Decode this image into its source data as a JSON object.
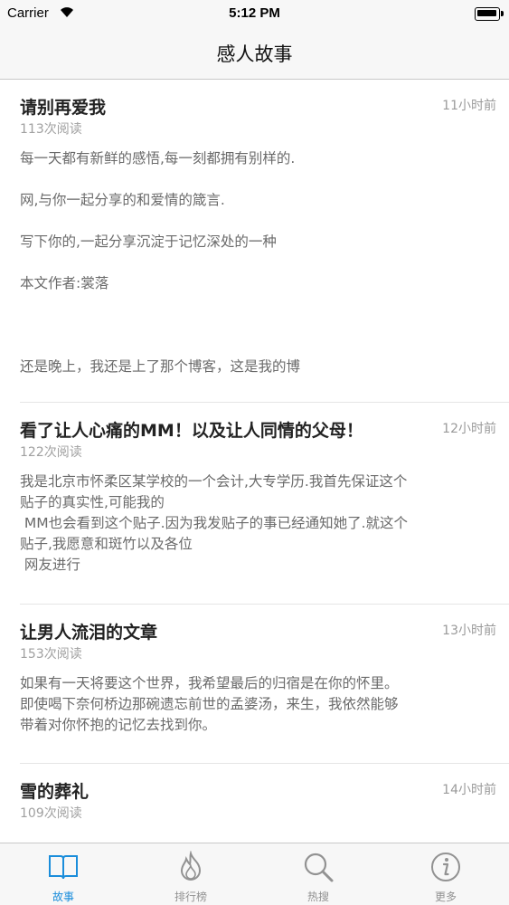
{
  "status_bar": {
    "carrier": "Carrier",
    "time": "5:12 PM"
  },
  "nav": {
    "title": "感人故事"
  },
  "articles": [
    {
      "title": "请别再爱我",
      "time": "11小时前",
      "reads": "113次阅读",
      "excerpt": [
        "每一天都有新鲜的感悟,每一刻都拥有别样的.",
        "网,与你一起分享的和爱情的箴言.",
        "写下你的,一起分享沉淀于记忆深处的一种",
        "本文作者:裳落",
        "还是晚上，我还是上了那个博客，这是我的博"
      ]
    },
    {
      "title": "看了让人心痛的MM！以及让人同情的父母！",
      "time": "12小时前",
      "reads": "122次阅读",
      "excerpt": [
        "我是北京市怀柔区某学校的一个会计,大专学历.我首先保证这个",
        "贴子的真实性,可能我的",
        " MM也会看到这个贴子.因为我发贴子的事已经通知她了.就这个",
        "贴子,我愿意和斑竹以及各位",
        " 网友进行"
      ]
    },
    {
      "title": "让男人流泪的文章",
      "time": "13小时前",
      "reads": "153次阅读",
      "excerpt": [
        "如果有一天将要这个世界，我希望最后的归宿是在你的怀里。",
        "即使喝下奈何桥边那碗遗忘前世的孟婆汤，来生，我依然能够",
        "带着对你怀抱的记忆去找到你。"
      ]
    },
    {
      "title": "雪的葬礼",
      "time": "14小时前",
      "reads": "109次阅读",
      "excerpt": []
    }
  ],
  "tabs": [
    {
      "label": "故事",
      "icon": "book-icon",
      "active": true
    },
    {
      "label": "排行榜",
      "icon": "flame-icon",
      "active": false
    },
    {
      "label": "热搜",
      "icon": "search-icon",
      "active": false
    },
    {
      "label": "更多",
      "icon": "info-icon",
      "active": false
    }
  ],
  "colors": {
    "accent": "#1a8ddb",
    "inactive": "#929292",
    "bar_bg": "#f7f7f7"
  }
}
